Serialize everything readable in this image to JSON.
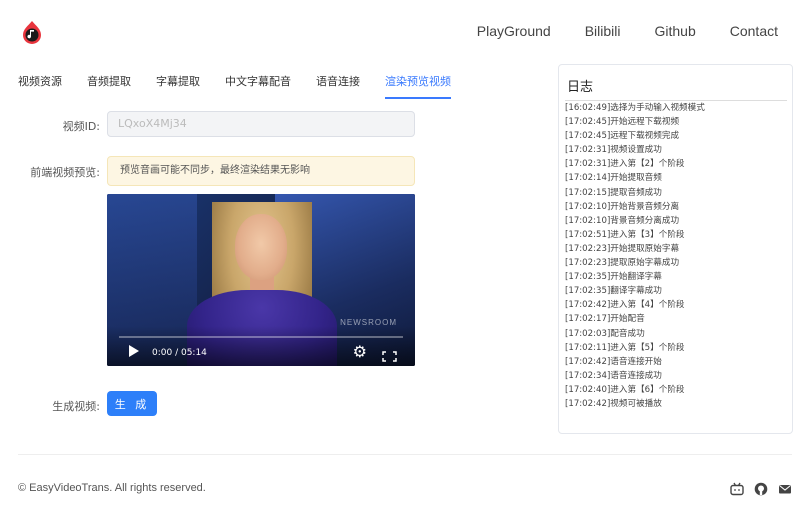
{
  "header": {
    "nav": [
      "PlayGround",
      "Bilibili",
      "Github",
      "Contact"
    ]
  },
  "tabs": [
    {
      "label": "视频资源",
      "active": false
    },
    {
      "label": "音频提取",
      "active": false
    },
    {
      "label": "字幕提取",
      "active": false
    },
    {
      "label": "中文字幕配音",
      "active": false
    },
    {
      "label": "语音连接",
      "active": false
    },
    {
      "label": "渲染预览视频",
      "active": true
    }
  ],
  "form": {
    "video_id_label": "视频ID:",
    "video_id_value": "LQxoX4Mj34",
    "preview_label": "前端视频预览:",
    "preview_notice": "预览音画可能不同步，最终渲染结果无影响",
    "generate_label": "生成视频:",
    "generate_button": "生 成"
  },
  "player": {
    "time": "0:00 / 05:14",
    "watermark": "ROOM  NEWSROOM"
  },
  "log": {
    "title": "日志",
    "entries": [
      "[16:02:49]选择为手动输入视频模式",
      "[17:02:45]开始远程下载视频",
      "[17:02:45]远程下载视频完成",
      "[17:02:31]视频设置成功",
      "[17:02:31]进入第【2】个阶段",
      "[17:02:14]开始提取音频",
      "[17:02:15]提取音频成功",
      "[17:02:10]开始背景音频分离",
      "[17:02:10]背景音频分离成功",
      "[17:02:51]进入第【3】个阶段",
      "[17:02:23]开始提取原始字幕",
      "[17:02:23]提取原始字幕成功",
      "[17:02:35]开始翻译字幕",
      "[17:02:35]翻译字幕成功",
      "[17:02:42]进入第【4】个阶段",
      "[17:02:17]开始配音",
      "[17:02:03]配音成功",
      "[17:02:11]进入第【5】个阶段",
      "[17:02:42]语音连接开始",
      "[17:02:34]语音连接成功",
      "[17:02:40]进入第【6】个阶段",
      "[17:02:42]视频可被播放"
    ]
  },
  "footer": {
    "copyright": "© EasyVideoTrans. All rights reserved."
  },
  "colors": {
    "accent": "#2d7ff9",
    "tab_active": "#3a7afe",
    "notice_bg": "#fdf6e3"
  }
}
